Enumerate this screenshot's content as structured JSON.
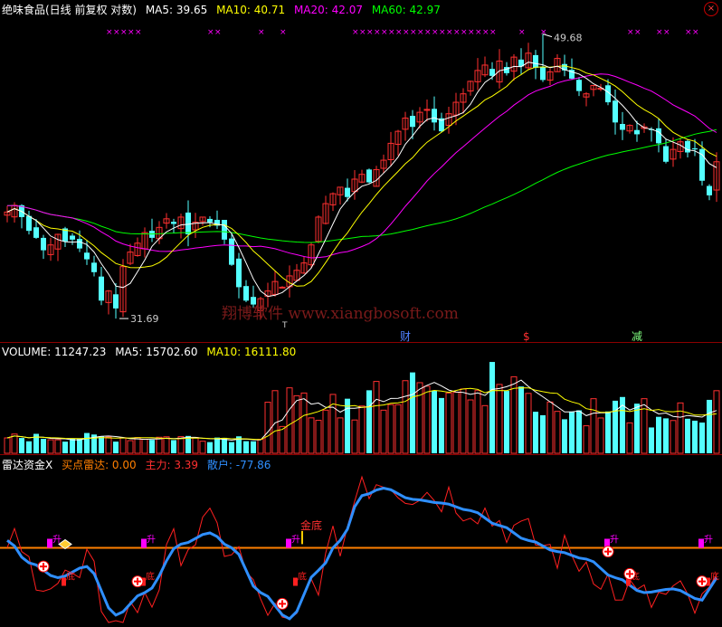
{
  "colors": {
    "up": "#ff3030",
    "down": "#54ffff",
    "ma5": "#ffffff",
    "ma10": "#ffff00",
    "ma20": "#ff00ff",
    "ma60": "#00ff00",
    "main_force": "#ff2020",
    "retail": "#2f8fff",
    "radar_line": "#ff7f00",
    "divider": "#8b0000"
  },
  "price_panel": {
    "title": "绝味食品(日线 前复权 对数)",
    "ma5_label": "MA5: 39.65",
    "ma10_label": "MA10: 40.71",
    "ma20_label": "MA20: 42.07",
    "ma60_label": "MA60: 42.97",
    "high_label": "49.68",
    "low_label": "31.69",
    "watermark": "翔博软件 www.xiangbosoft.com",
    "events": [
      {
        "label": "财",
        "color": "#5080ff",
        "index": 55
      },
      {
        "label": "$",
        "color": "#ff3030",
        "index": 72
      },
      {
        "label": "减",
        "color": "#80ff80",
        "index": 87
      }
    ],
    "ex_marker": "T",
    "x_markers": "×"
  },
  "volume_panel": {
    "volume_label": "VOLUME: 11247.23",
    "ma5_label": "MA5: 15702.60",
    "ma10_label": "MA10: 16111.80"
  },
  "radar_panel": {
    "title": "雷达资金X",
    "buy_label": "买点雷达: 0.00",
    "main_label": "主力: 3.39",
    "retail_label": "散户: -77.86",
    "golden_bottom": "金底",
    "bottom_label": "底",
    "rise_label": "升"
  },
  "chart_data": {
    "type": "candlestick",
    "scale": "log",
    "high": 49.68,
    "low": 31.69,
    "closes": [
      37.5,
      37.9,
      37.2,
      36.4,
      36.0,
      35.3,
      35.6,
      36.2,
      35.8,
      35.9,
      35.4,
      34.8,
      34.1,
      32.6,
      33.1,
      32.2,
      34.4,
      35.2,
      35.7,
      36.3,
      36.0,
      36.6,
      37.1,
      36.8,
      37.2,
      36.2,
      36.9,
      37.2,
      36.9,
      36.7,
      35.9,
      34.5,
      33.3,
      32.6,
      32.4,
      32.7,
      33.1,
      33.6,
      33.3,
      33.9,
      34.2,
      34.6,
      35.6,
      37.2,
      38.0,
      38.6,
      39.0,
      38.4,
      39.5,
      39.8,
      39.3,
      40.1,
      40.7,
      41.8,
      42.6,
      43.5,
      42.9,
      43.9,
      44.1,
      43.2,
      42.6,
      43.8,
      44.6,
      45.2,
      46.1,
      46.9,
      47.3,
      46.5,
      47.6,
      46.7,
      47.9,
      47.2,
      48.2,
      47.1,
      46.2,
      46.8,
      47.8,
      46.9,
      46.3,
      45.4,
      45.2,
      45.8,
      45.6,
      44.6,
      43.2,
      42.7,
      43.0,
      42.4,
      42.9,
      42.7,
      41.8,
      40.6,
      41.4,
      41.9,
      41.2,
      41.4,
      39.4,
      38.5,
      40.6
    ],
    "radar": {
      "retail_range": [
        -100,
        100
      ],
      "main_range": [
        -100,
        100
      ],
      "buy_line": 0
    }
  }
}
